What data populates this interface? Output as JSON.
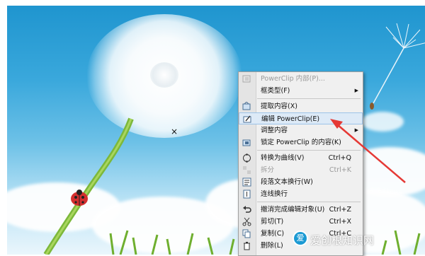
{
  "menu": {
    "items": [
      {
        "label": "PowerClip 内部(P)...",
        "shortcut": "",
        "submenu": false,
        "disabled": true,
        "icon": "powerclip-icon"
      },
      {
        "label": "框类型(F)",
        "shortcut": "",
        "submenu": true,
        "disabled": false,
        "icon": ""
      },
      {
        "label": "提取内容(X)",
        "shortcut": "",
        "submenu": false,
        "disabled": false,
        "icon": "extract-icon"
      },
      {
        "label": "编辑 PowerClip(E)",
        "shortcut": "",
        "submenu": false,
        "disabled": false,
        "icon": "edit-icon",
        "highlighted": true
      },
      {
        "label": "调整内容",
        "shortcut": "",
        "submenu": true,
        "disabled": false,
        "icon": ""
      },
      {
        "label": "锁定 PowerClip 的内容(K)",
        "shortcut": "",
        "submenu": false,
        "disabled": false,
        "icon": "lock-icon"
      },
      {
        "label": "转换为曲线(V)",
        "shortcut": "Ctrl+Q",
        "submenu": false,
        "disabled": false,
        "icon": "curve-icon"
      },
      {
        "label": "拆分",
        "shortcut": "Ctrl+K",
        "submenu": false,
        "disabled": true,
        "icon": "split-icon"
      },
      {
        "label": "段落文本换行(W)",
        "shortcut": "",
        "submenu": false,
        "disabled": false,
        "icon": "wrap-icon"
      },
      {
        "label": "连线换行",
        "shortcut": "",
        "submenu": false,
        "disabled": false,
        "icon": "link-wrap-icon"
      },
      {
        "label": "撤消完成编辑对象(U)",
        "shortcut": "Ctrl+Z",
        "submenu": false,
        "disabled": false,
        "icon": "undo-icon"
      },
      {
        "label": "剪切(T)",
        "shortcut": "Ctrl+X",
        "submenu": false,
        "disabled": false,
        "icon": "cut-icon"
      },
      {
        "label": "复制(C)",
        "shortcut": "Ctrl+C",
        "submenu": false,
        "disabled": false,
        "icon": "copy-icon"
      },
      {
        "label": "删除(L)",
        "shortcut": "",
        "submenu": false,
        "disabled": false,
        "icon": "delete-icon"
      }
    ]
  },
  "canvas": {
    "marker": "×"
  },
  "watermark": {
    "text": "爱创根知识网",
    "logo": "爱"
  },
  "colors": {
    "arrow": "#e53935",
    "menu_bg": "#f0f0f0",
    "highlight": "#ddeaf7"
  }
}
